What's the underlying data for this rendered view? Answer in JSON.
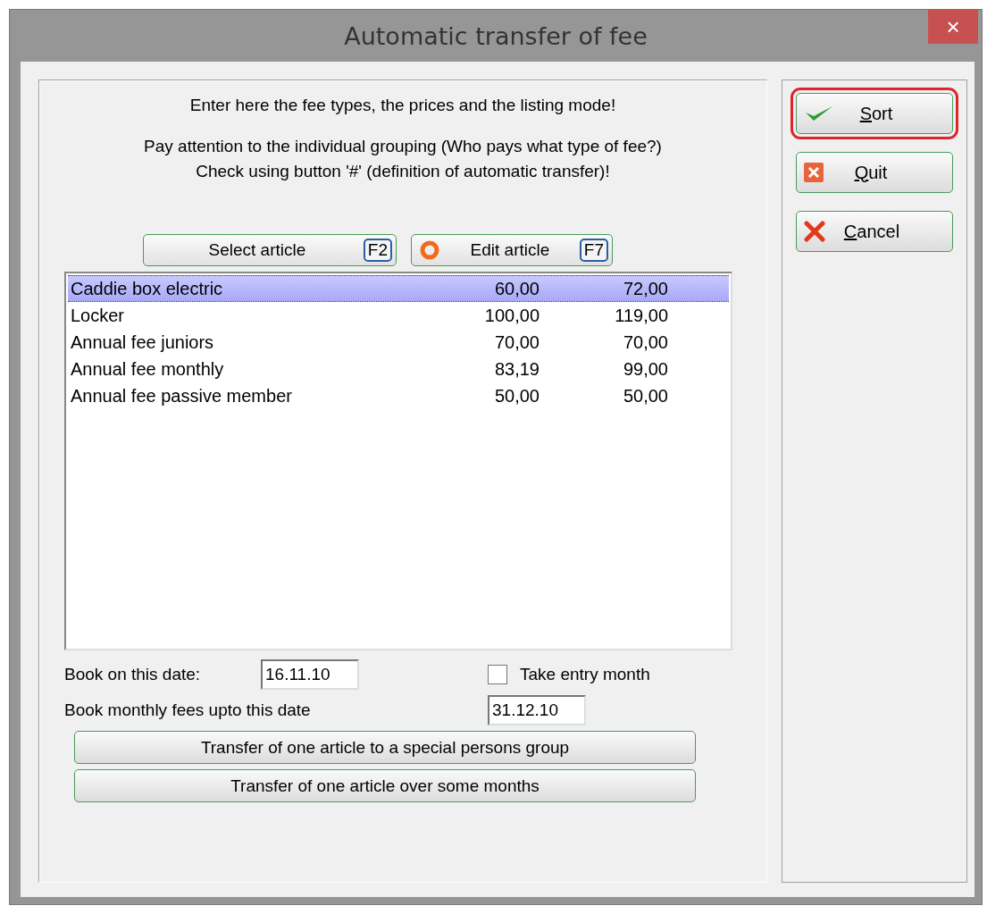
{
  "window": {
    "title": "Automatic transfer of fee",
    "close": "×"
  },
  "instructions": [
    "Enter here the fee types, the prices and the listing mode!",
    "Pay attention to the individual grouping (Who pays what type of fee?)\nCheck using button '#' (definition of automatic transfer)!"
  ],
  "article_buttons": [
    {
      "label": "Select article",
      "key": "F2"
    },
    {
      "label": "Edit article",
      "key": "F7"
    }
  ],
  "articles": [
    {
      "name": "Caddie box electric",
      "net": "60,00",
      "gross": "72,00",
      "selected": true
    },
    {
      "name": "Locker",
      "net": "100,00",
      "gross": "119,00",
      "selected": false
    },
    {
      "name": "Annual fee juniors",
      "net": "70,00",
      "gross": "70,00",
      "selected": false
    },
    {
      "name": "Annual fee monthly",
      "net": "83,19",
      "gross": "99,00",
      "selected": false
    },
    {
      "name": "Annual fee passive member",
      "net": "50,00",
      "gross": "50,00",
      "selected": false
    }
  ],
  "book_date": {
    "label": "Book on this date:",
    "value": "16.11.10"
  },
  "take_entry_month": {
    "label": "Take entry month",
    "checked": false
  },
  "monthly_date": {
    "label": "Book monthly fees upto this date",
    "value": "31.12.10"
  },
  "transfer_buttons": [
    "Transfer of one article to a special persons group",
    "Transfer of one article over some months"
  ],
  "side_buttons": [
    {
      "label": "Sort",
      "focused": true,
      "mnemonic": true
    },
    {
      "label": "Quit",
      "focused": false,
      "mnemonic": true
    },
    {
      "label": "Cancel",
      "focused": false,
      "mnemonic": true
    }
  ]
}
